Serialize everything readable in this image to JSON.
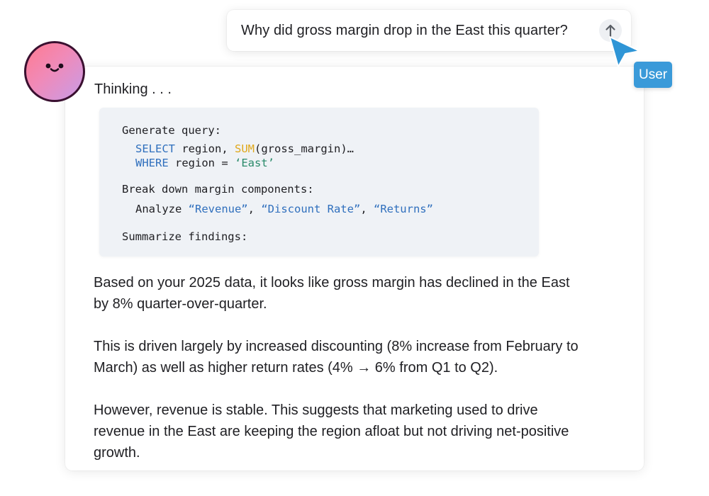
{
  "user_message": {
    "text": "Why did gross margin drop in the East this quarter?",
    "send_icon": "arrow-up-icon"
  },
  "cursor": {
    "label": "User",
    "color": "#3a9ad9"
  },
  "assistant": {
    "thinking_label": "Thinking . . .",
    "steps": {
      "step1_title": "Generate query:",
      "step1_select_kw": "SELECT",
      "step1_select_mid": " region, ",
      "step1_sum_fn": "SUM",
      "step1_select_tail": "(gross_margin)…",
      "step1_where_kw": "WHERE",
      "step1_where_mid": " region = ",
      "step1_where_value": "‘East’",
      "step2_title": "Break down margin components:",
      "step2_analyze": "Analyze ",
      "step2_item1": "“Revenue”",
      "step2_sep1": ", ",
      "step2_item2": "“Discount Rate”",
      "step2_sep2": ", ",
      "step2_item3": "“Returns”",
      "step3_title": "Summarize findings:"
    },
    "paragraphs": [
      "Based on your 2025 data, it looks like gross margin has declined in the East by 8% quarter-over-quarter.",
      "This is driven largely by increased discounting (8% increase from February to March) as well as higher return rates (4% → 6% from Q1 to Q2).",
      "However, revenue is stable. This suggests that marketing used to drive revenue in the East are keeping the region afloat but not driving net-positive growth."
    ]
  },
  "colors": {
    "accent": "#3a9ad9",
    "code_keyword": "#2f6fbd",
    "code_function": "#e0a81c",
    "code_string": "#2a8a6a",
    "code_background": "#eff2f6"
  }
}
